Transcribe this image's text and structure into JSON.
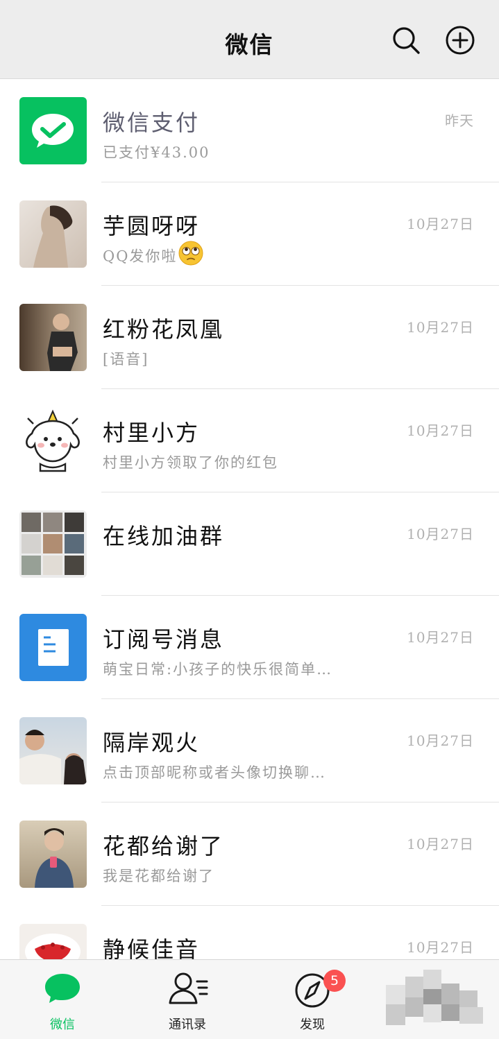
{
  "header": {
    "title": "微信"
  },
  "chats": [
    {
      "name": "微信支付",
      "preview": "已支付¥43.00",
      "time": "昨天"
    },
    {
      "name": "芋圆呀呀",
      "preview": "QQ发你啦",
      "time": "10月27日"
    },
    {
      "name": "红粉花凤凰",
      "preview": "[语音]",
      "time": "10月27日"
    },
    {
      "name": "村里小方",
      "preview": "村里小方领取了你的红包",
      "time": "10月27日"
    },
    {
      "name": "在线加油群",
      "preview": "",
      "time": "10月27日"
    },
    {
      "name": "订阅号消息",
      "preview": "萌宝日常:小孩子的快乐很简单…",
      "time": "10月27日"
    },
    {
      "name": "隔岸观火",
      "preview": "点击顶部昵称或者头像切换聊…",
      "time": "10月27日"
    },
    {
      "name": "花都给谢了",
      "preview": "我是花都给谢了",
      "time": "10月27日"
    },
    {
      "name": "静候佳音",
      "preview": "",
      "time": "10月27日"
    }
  ],
  "tabs": [
    {
      "label": "微信",
      "active": true
    },
    {
      "label": "通讯录",
      "active": false
    },
    {
      "label": "发现",
      "active": false,
      "badge": "5"
    }
  ],
  "colors": {
    "brand_green": "#07c160",
    "badge_red": "#fa5151",
    "subscription_blue": "#2e8ae0"
  }
}
